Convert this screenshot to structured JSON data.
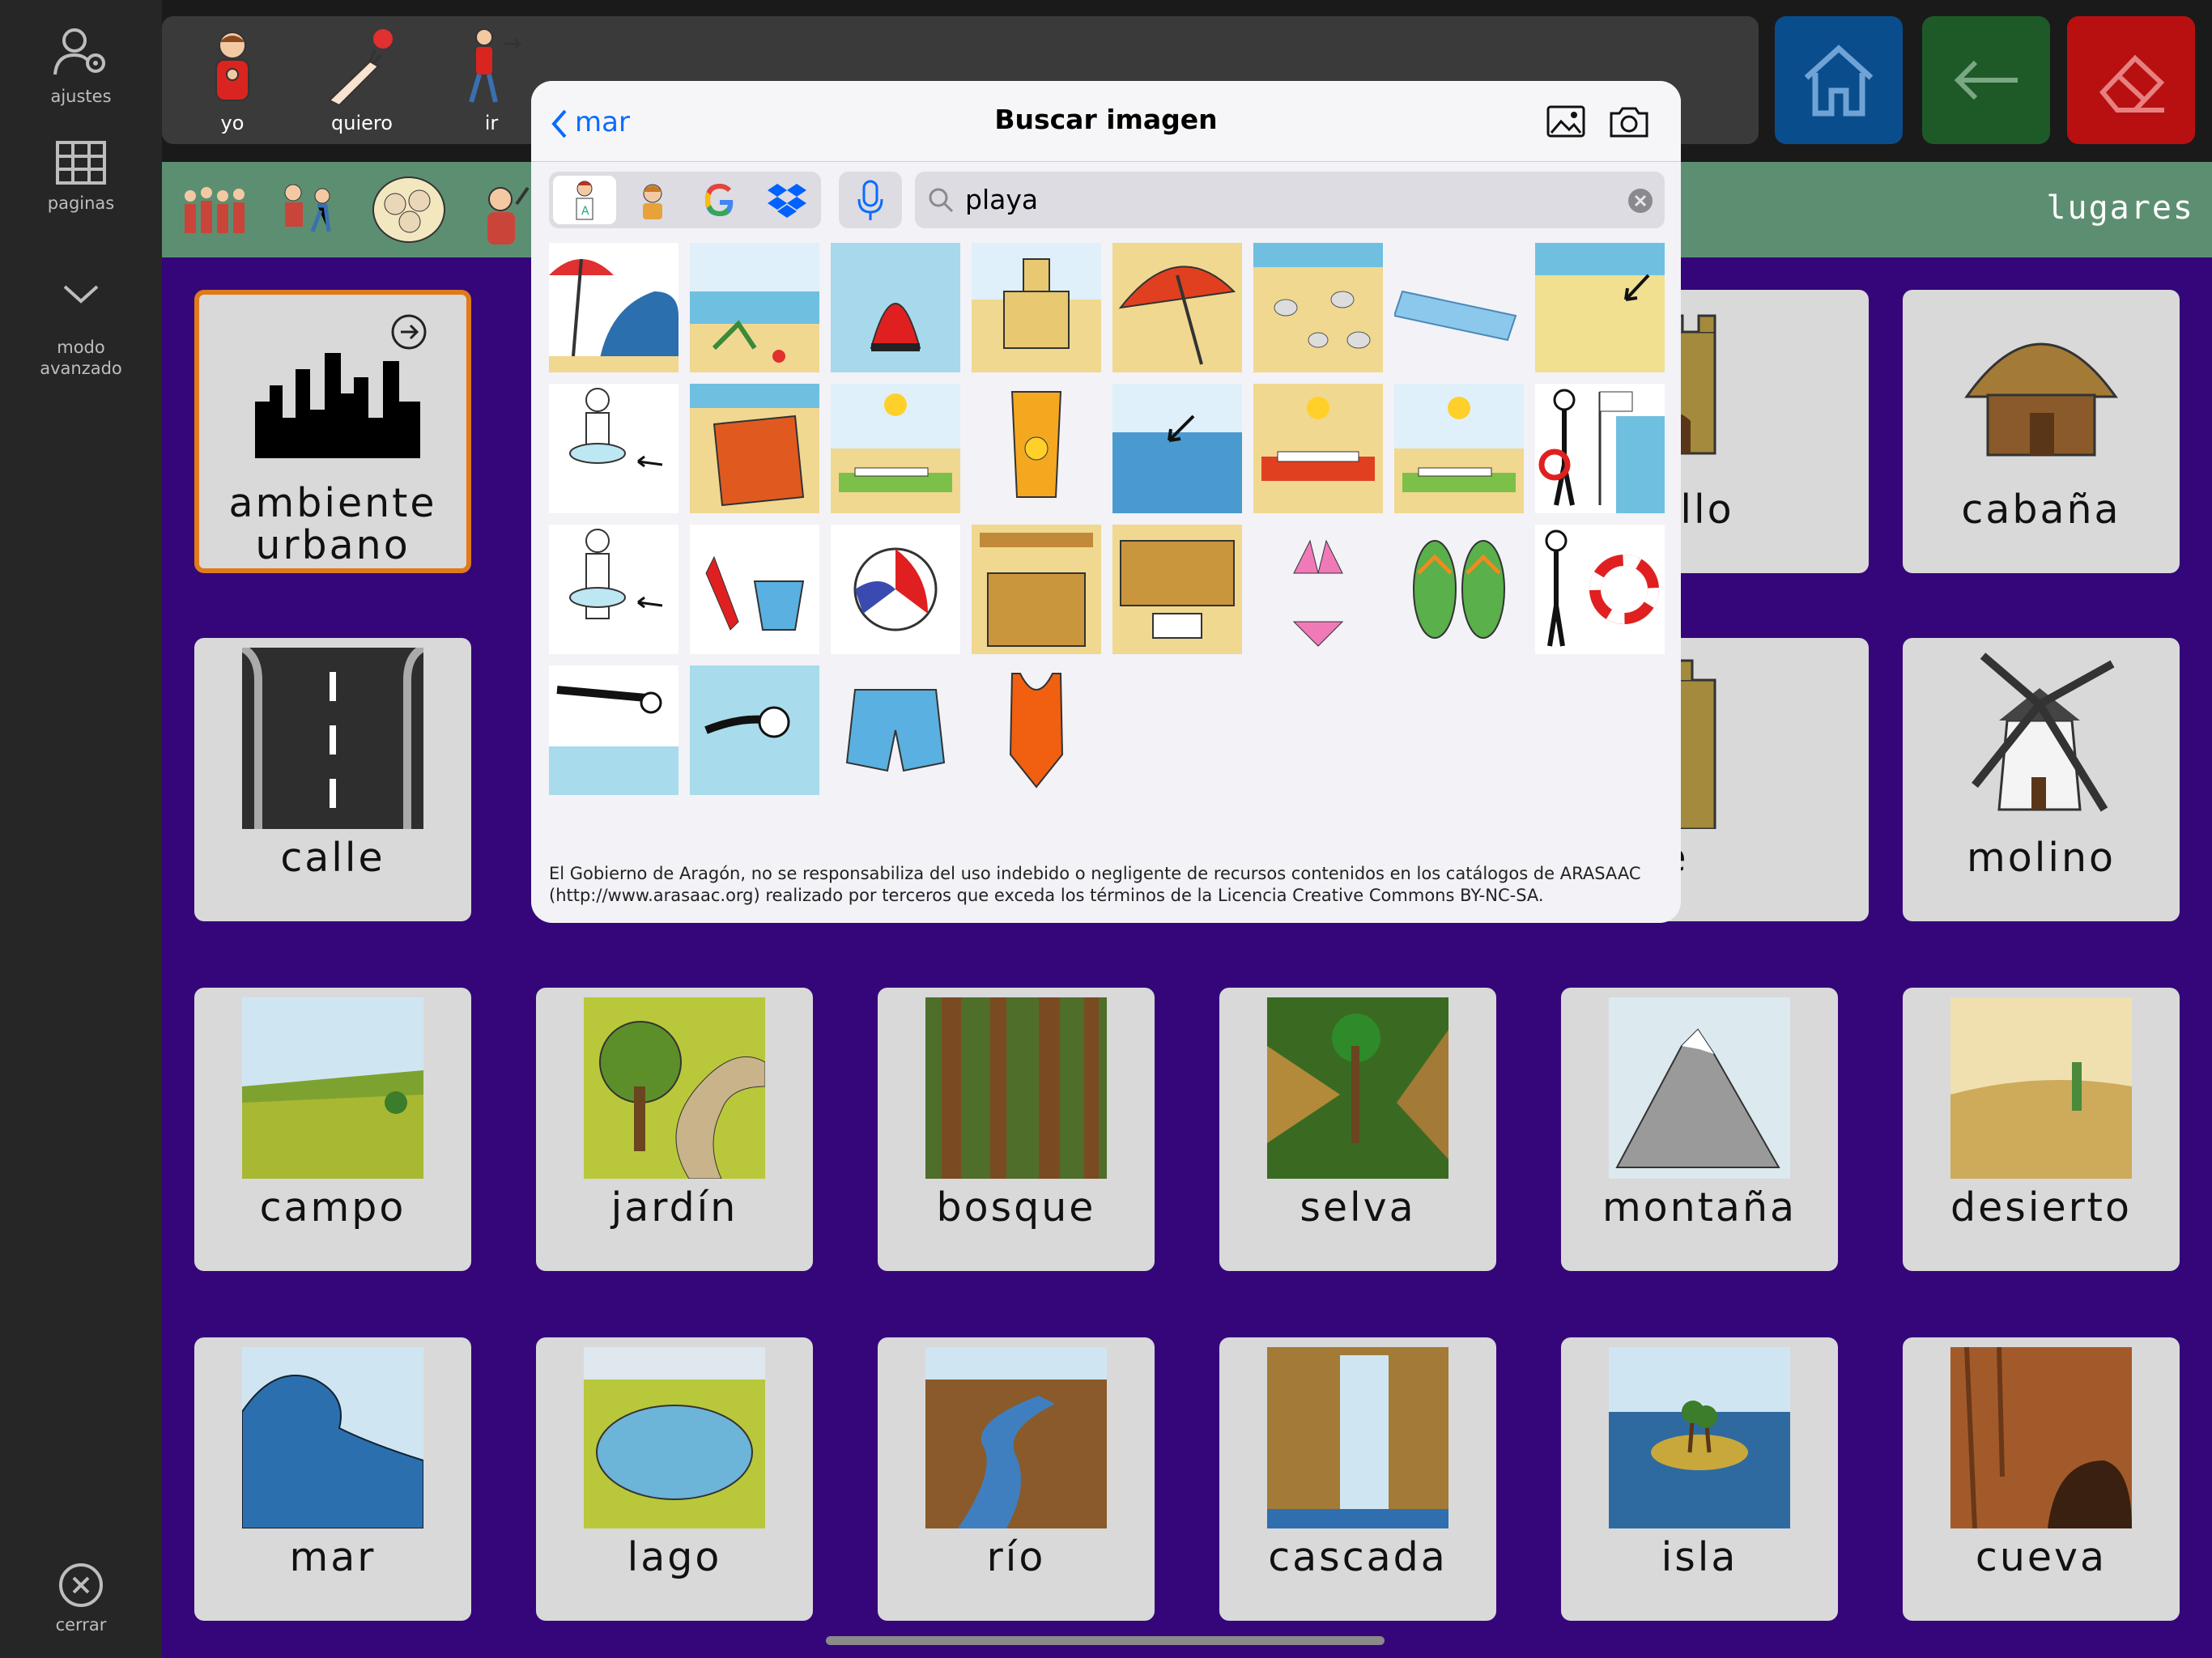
{
  "sidebar": {
    "settings_label": "ajustes",
    "pages_label": "paginas",
    "mode_label": "modo\navanzado",
    "close_label": "cerrar"
  },
  "sentence": {
    "words": [
      {
        "label": "yo",
        "icon": "person-pointing-self-icon"
      },
      {
        "label": "quiero",
        "icon": "hand-reaching-ball-icon"
      },
      {
        "label": "ir",
        "icon": "person-walking-icon"
      }
    ]
  },
  "toolbar": {
    "home_color": "#0a4d8c",
    "back_color": "#1e5a28",
    "clear_color": "#b81010"
  },
  "category": {
    "title": "lugares"
  },
  "grid": {
    "background": "#35067a",
    "tiles": [
      {
        "label": "ambiente\nurbano",
        "icon": "city-skyline-icon"
      },
      {
        "label": "cabaña",
        "icon": "hut-icon"
      },
      {
        "label": "stillo",
        "icon": "castle-icon"
      },
      {
        "label": "calle",
        "icon": "road-icon"
      },
      {
        "label": "rre",
        "icon": "tower-icon"
      },
      {
        "label": "molino",
        "icon": "windmill-icon"
      },
      {
        "label": "campo",
        "icon": "field-icon"
      },
      {
        "label": "jardín",
        "icon": "garden-icon"
      },
      {
        "label": "bosque",
        "icon": "forest-icon"
      },
      {
        "label": "selva",
        "icon": "jungle-icon"
      },
      {
        "label": "montaña",
        "icon": "mountain-icon"
      },
      {
        "label": "desierto",
        "icon": "desert-icon"
      },
      {
        "label": "mar",
        "icon": "wave-icon"
      },
      {
        "label": "lago",
        "icon": "lake-icon"
      },
      {
        "label": "río",
        "icon": "river-icon"
      },
      {
        "label": "cascada",
        "icon": "waterfall-icon"
      },
      {
        "label": "isla",
        "icon": "island-icon"
      },
      {
        "label": "cueva",
        "icon": "cave-icon"
      }
    ]
  },
  "modal": {
    "back_label": "mar",
    "title": "Buscar imagen",
    "search_query": "playa",
    "sources": [
      "arasaac-source-icon",
      "child-source-icon",
      "google-icon",
      "dropbox-icon"
    ],
    "results": [
      "beach-umbrella-wave-icon",
      "beach-chair-icon",
      "buoy-icon",
      "sandcastle-icon",
      "red-parasol-icon",
      "seashells-icon",
      "air-mattress-icon",
      "sand-arrow-icon",
      "girl-float-icon",
      "beach-towel-icon",
      "sunbathing-icon",
      "sunscreen-icon",
      "sea-arrow-icon",
      "lying-towel-icon",
      "sunbathing-sun-icon",
      "lifeguard-icon",
      "boy-float-icon",
      "bucket-spade-icon",
      "beach-ball-icon",
      "beach-bar-icon",
      "beach-restaurant-icon",
      "bikini-icon",
      "flip-flops-icon",
      "lifebuoy-person-icon",
      "diving-icon",
      "swimming-icon",
      "swim-shorts-icon",
      "swimsuit-icon"
    ],
    "disclaimer": "El Gobierno de Aragón, no se responsabiliza del uso indebido o negligente de recursos contenidos en los catálogos de ARASAAC (http://www.arasaac.org) realizado por terceros que exceda los términos de la Licencia Creative Commons BY-NC-SA."
  }
}
